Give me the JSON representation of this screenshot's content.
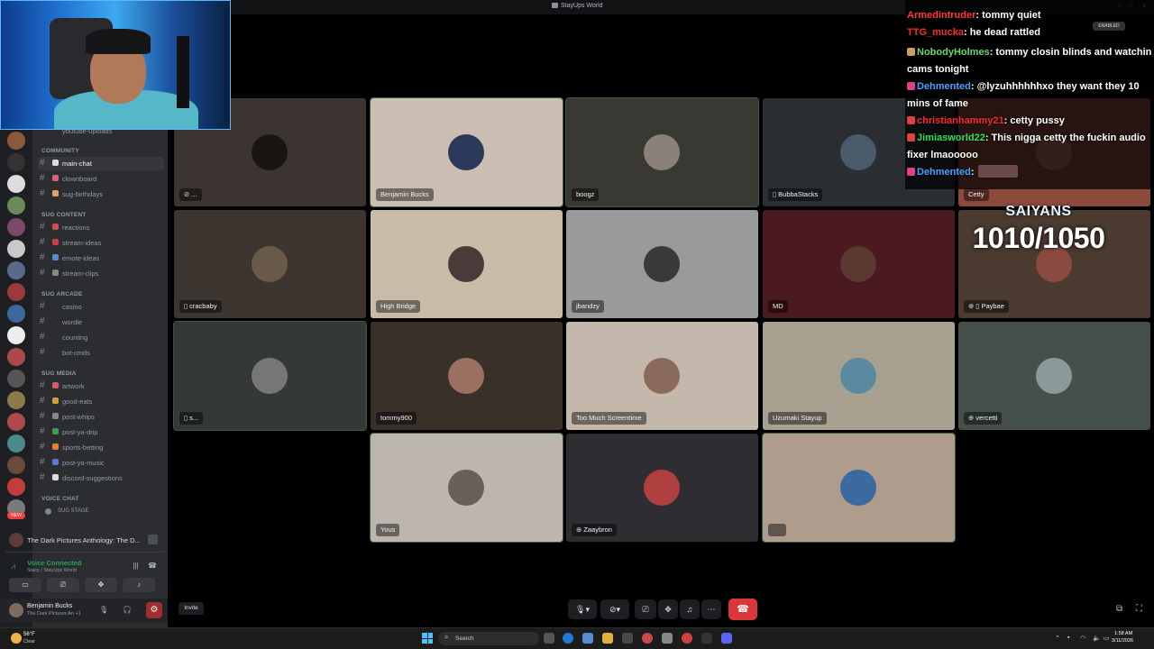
{
  "window": {
    "title": "StayUps World"
  },
  "sidebar": {
    "top_channel": "youtube-uploads",
    "categories": {
      "community": "COMMUNITY",
      "content": "SUG CONTENT",
      "arcade": "SUG ARCADE",
      "media": "SUG MEDIA",
      "voice": "VOICE CHAT"
    },
    "community_channels": [
      "main-chat",
      "clownboard",
      "sug-birthdays"
    ],
    "content_channels": [
      "reactions",
      "stream-ideas",
      "emote-ideas",
      "stream-clips"
    ],
    "arcade_channels": [
      "casino",
      "wordle",
      "counting",
      "bot-cmds"
    ],
    "media_channels": [
      "artwork",
      "good-eats",
      "post-whips",
      "post-ya-drip",
      "sports-betting",
      "post-ya-music",
      "discord-suggestions"
    ],
    "voice_channels": [
      "SUG STAGE"
    ],
    "new_badge": "NEW"
  },
  "activity": {
    "name": "The Dark Pictures Anthology: The D..."
  },
  "voice": {
    "status": "Voice Connected",
    "channel": "Stacy / StayUps World"
  },
  "user": {
    "name": "Benjamin Bucks",
    "subtext": "The Dark Pictures An +1"
  },
  "tiles": [
    {
      "label": "..."
    },
    {
      "label": "Benjamin Bucks"
    },
    {
      "label": "boogz"
    },
    {
      "label": "BubbaStacks"
    },
    {
      "label": "Cetty"
    },
    {
      "label": "cracbaby"
    },
    {
      "label": "High Bridge"
    },
    {
      "label": "jbandzy"
    },
    {
      "label": "MD"
    },
    {
      "label": "Paybae"
    },
    {
      "label": "s..."
    },
    {
      "label": "tommy900"
    },
    {
      "label": "Too Much Screentime"
    },
    {
      "label": "Uzumaki Stayup"
    },
    {
      "label": "vercetti"
    },
    {
      "label": "Yous"
    },
    {
      "label": "Zaaybron"
    },
    {
      "label": ""
    }
  ],
  "controls": {
    "invite_label": "Invite"
  },
  "chat": {
    "enabled_label": "ENABLED",
    "messages": [
      {
        "user": "Armedintruder",
        "text": ": tommy quiet",
        "color": "#ff3b3b"
      },
      {
        "user": "TTG_mucka",
        "text": ":  he dead rattled",
        "color": "#ff2a2a"
      },
      {
        "user": "NobodyHolmes",
        "text": ": tommy closin blinds and watchin cams tonight",
        "color": "#6bd86b"
      },
      {
        "user": "Dehmented",
        "text": ": @lyzuhhhhhhxo they want they 10 mins of fame",
        "color": "#4aa3ff"
      },
      {
        "user": "christianhammy21",
        "text": ": cetty pussy",
        "color": "#ff2a2a"
      },
      {
        "user": "Jimiasworld22",
        "text": ": This nigga cetty the fuckin audio fixer lmaooooo",
        "color": "#38e05a"
      },
      {
        "user": "Dehmented",
        "text": ":",
        "color": "#4aa3ff"
      }
    ]
  },
  "goal": {
    "label": "SAIYANS",
    "count": "1010/1050"
  },
  "taskbar": {
    "weather_temp": "56°F",
    "weather_desc": "Clear",
    "search_placeholder": "Search",
    "time": "1:58 AM",
    "date": "3/11/2026"
  }
}
